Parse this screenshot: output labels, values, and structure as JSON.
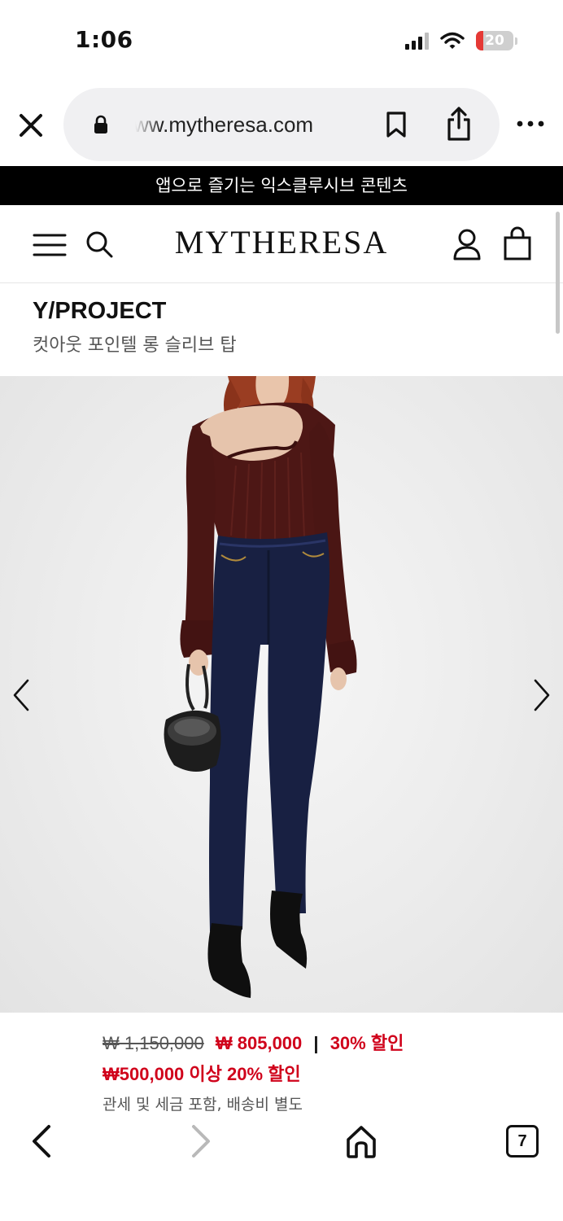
{
  "status_bar": {
    "time": "1:06",
    "battery_level": "20",
    "battery_fraction": 0.2,
    "icons": [
      "cellular-signal-icon",
      "wifi-icon",
      "battery-icon"
    ]
  },
  "browser": {
    "url": "ww.mytheresa.com",
    "icons": [
      "close-icon",
      "lock-icon",
      "bookmark-icon",
      "share-icon",
      "more-icon"
    ]
  },
  "promo_banner": {
    "text": "앱으로 즐기는 익스클루시브 콘텐츠"
  },
  "site_header": {
    "logo": "MYTHERESA",
    "icons": [
      "menu-icon",
      "search-icon",
      "account-icon",
      "shopping-bag-icon"
    ]
  },
  "product": {
    "brand": "Y/PROJECT",
    "name": "컷아웃 포인텔 롱 슬리브 탑",
    "image_nav": [
      "chevron-left-icon",
      "chevron-right-icon"
    ]
  },
  "price": {
    "original": "₩ 1,150,000",
    "sale": "₩ 805,000",
    "separator": "|",
    "discount": "30% 할인",
    "promo": "₩500,000 이상 20% 할인",
    "tax_note": "관세 및 세금 포함, 배송비 별도"
  },
  "bottom_toolbar": {
    "tab_count": "7",
    "icons": [
      "back-arrow-icon",
      "forward-arrow-icon",
      "home-icon",
      "tabs-icon"
    ]
  },
  "colors": {
    "sale_red": "#d0021b",
    "banner_black": "#000000",
    "url_pill": "#f0f0f2",
    "battery_red": "#e53935"
  }
}
